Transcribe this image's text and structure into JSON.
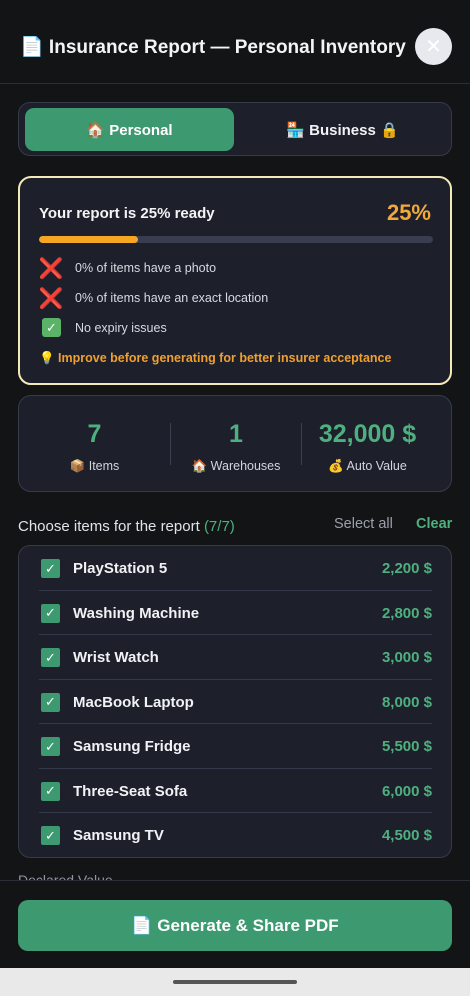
{
  "header": {
    "title": "📄 Insurance Report — Personal Inventory",
    "close_glyph": "✕"
  },
  "tabs": [
    {
      "label": "🏠 Personal",
      "active": true
    },
    {
      "label": "🏪 Business 🔒",
      "active": false
    }
  ],
  "readiness": {
    "title": "Your report is 25% ready",
    "percent_label": "25%",
    "progress_fraction": 0.25,
    "checks": [
      {
        "status": "fail",
        "icon": "cross-icon",
        "glyph": "❌",
        "text": "0% of items have a photo"
      },
      {
        "status": "fail",
        "icon": "cross-icon",
        "glyph": "❌",
        "text": "0% of items have an exact location"
      },
      {
        "status": "pass",
        "icon": "check-icon",
        "glyph": "✓",
        "text": "No expiry issues"
      }
    ],
    "tip": "💡 Improve before generating for better insurer acceptance"
  },
  "stats": [
    {
      "value": "7",
      "label": "📦 Items"
    },
    {
      "value": "1",
      "label": "🏠 Warehouses"
    },
    {
      "value": "32,000 $",
      "label": "💰 Auto Value"
    }
  ],
  "items_section": {
    "title": "Choose items for the report",
    "count": "(7/7)",
    "select_all": "Select all",
    "clear": "Clear"
  },
  "items": [
    {
      "name": "PlayStation 5",
      "value": "2,200 $",
      "checked": true
    },
    {
      "name": "Washing Machine",
      "value": "2,800 $",
      "checked": true
    },
    {
      "name": "Wrist Watch",
      "value": "3,000 $",
      "checked": true
    },
    {
      "name": "MacBook Laptop",
      "value": "8,000 $",
      "checked": true
    },
    {
      "name": "Samsung Fridge",
      "value": "5,500 $",
      "checked": true
    },
    {
      "name": "Three-Seat Sofa",
      "value": "6,000 $",
      "checked": true
    },
    {
      "name": "Samsung TV",
      "value": "4,500 $",
      "checked": true
    }
  ],
  "declared_value_label": "Declared Value",
  "checkbox_glyph": "✓",
  "generate_button": "📄 Generate & Share PDF",
  "colors": {
    "accent": "#3d9970",
    "warning": "#f2a93b",
    "card": "#1d1f2b",
    "background": "#131416"
  }
}
